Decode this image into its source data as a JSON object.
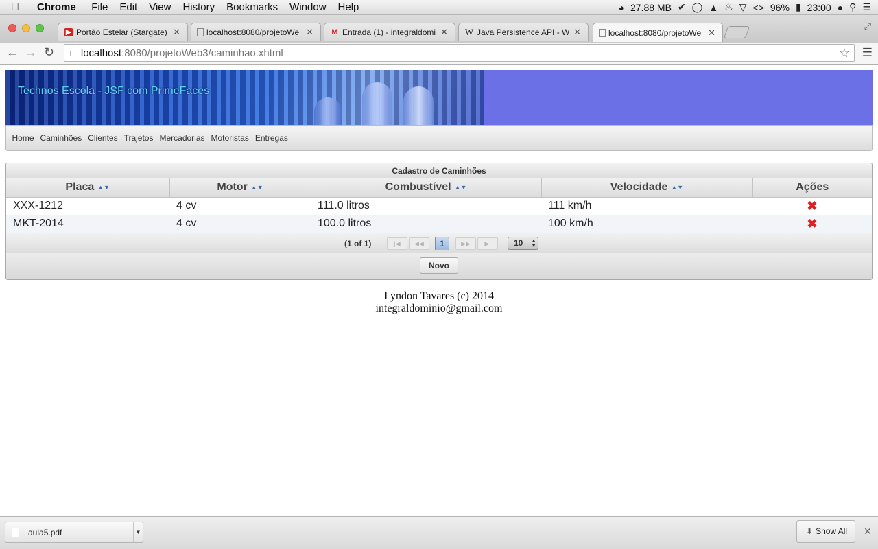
{
  "menubar": {
    "apple": "",
    "items": [
      "Chrome",
      "File",
      "Edit",
      "View",
      "History",
      "Bookmarks",
      "Window",
      "Help"
    ],
    "memory": "27.88 MB",
    "battery": "96%",
    "clock": "23:00"
  },
  "tabs": [
    {
      "title": "Portão Estelar (Stargate) -",
      "favicon": "youtube-icon"
    },
    {
      "title": "localhost:8080/projetoWe",
      "favicon": "page-icon"
    },
    {
      "title": "Entrada (1) - integraldomi",
      "favicon": "gmail-icon"
    },
    {
      "title": "Java Persistence API - Wiki",
      "favicon": "wikipedia-icon"
    },
    {
      "title": "localhost:8080/projetoWe",
      "favicon": "page-icon",
      "active": true
    }
  ],
  "omnibox": {
    "host": "localhost",
    "path": ":8080/projetoWeb3/caminhao.xhtml"
  },
  "banner": {
    "title": "Technos Escola - JSF com PrimeFaces"
  },
  "nav": {
    "items": [
      "Home",
      "Caminhões",
      "Clientes",
      "Trajetos",
      "Mercadorias",
      "Motoristas",
      "Entregas"
    ]
  },
  "panel": {
    "caption": "Cadastro de Caminhões",
    "columns": [
      "Placa",
      "Motor",
      "Combustível",
      "Velocidade",
      "Ações"
    ],
    "rows": [
      [
        "XXX-1212",
        "4 cv",
        "111.0 litros",
        "111 km/h"
      ],
      [
        "MKT-2014",
        "4 cv",
        "100.0 litros",
        "100 km/h"
      ]
    ],
    "paginator": {
      "current_report": "(1 of 1)",
      "page": "1",
      "rows_per_page": "10"
    },
    "new_button": "Novo"
  },
  "credits": {
    "line1": "Lyndon Tavares (c) 2014",
    "line2": "integraldominio@gmail.com"
  },
  "download_shelf": {
    "file": "aula5.pdf",
    "show_all": "Show All"
  },
  "colors": {
    "banner": "#6b70e6",
    "delete": "#e02020",
    "banner_title": "#5fd3f0"
  }
}
